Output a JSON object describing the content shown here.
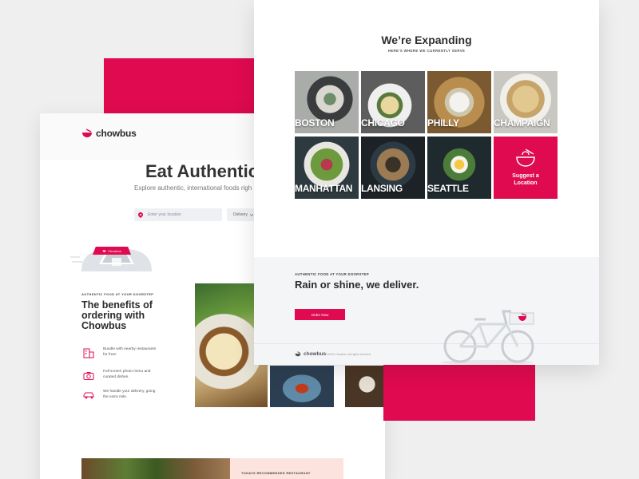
{
  "back_page": {
    "logo_text": "chowbus",
    "hero_title": "Eat Authentic",
    "hero_subtitle": "Explore authentic, international foods righ",
    "location_placeholder": "Enter your location",
    "delivery_option": "Delivery",
    "car_sign_text": "Chowbus",
    "benefits_kicker": "AUTHENTIC FOOD AT YOUR DOORSTEP",
    "benefits_title": "The benefits of ordering with Chowbus",
    "benefits": [
      {
        "icon": "building-icon",
        "text": "Bundle with nearby restaurants for free!"
      },
      {
        "icon": "camera-icon",
        "text": "Full screen photo menu and curated dishes."
      },
      {
        "icon": "car-icon",
        "text": "We handle your delivery, going the extra mile."
      }
    ],
    "recommended_label": "TODAYS RECOMMENDED RESTAURANT"
  },
  "front_page": {
    "title": "We’re Expanding",
    "subtitle": "HERE’S WHERE WE CURRENTLY SERVE",
    "cities": [
      "BOSTON",
      "CHICAGO",
      "PHILLY",
      "CHAMPAIGN",
      "MANHATTAN",
      "LANSING",
      "SEATTLE"
    ],
    "suggest_label": "Suggest a Location",
    "deliver_kicker": "AUTHENTIC FOOD AT YOUR DOORSTEP",
    "deliver_title": "Rain or shine, we deliver.",
    "order_button": "Order Now",
    "footer_logo": "chowbus",
    "footer_copyright": "©2019 Chowbus. All rights reserved."
  },
  "colors": {
    "brand": "#df0a4f",
    "background": "#efefef",
    "panel_pink": "#fde3de"
  }
}
